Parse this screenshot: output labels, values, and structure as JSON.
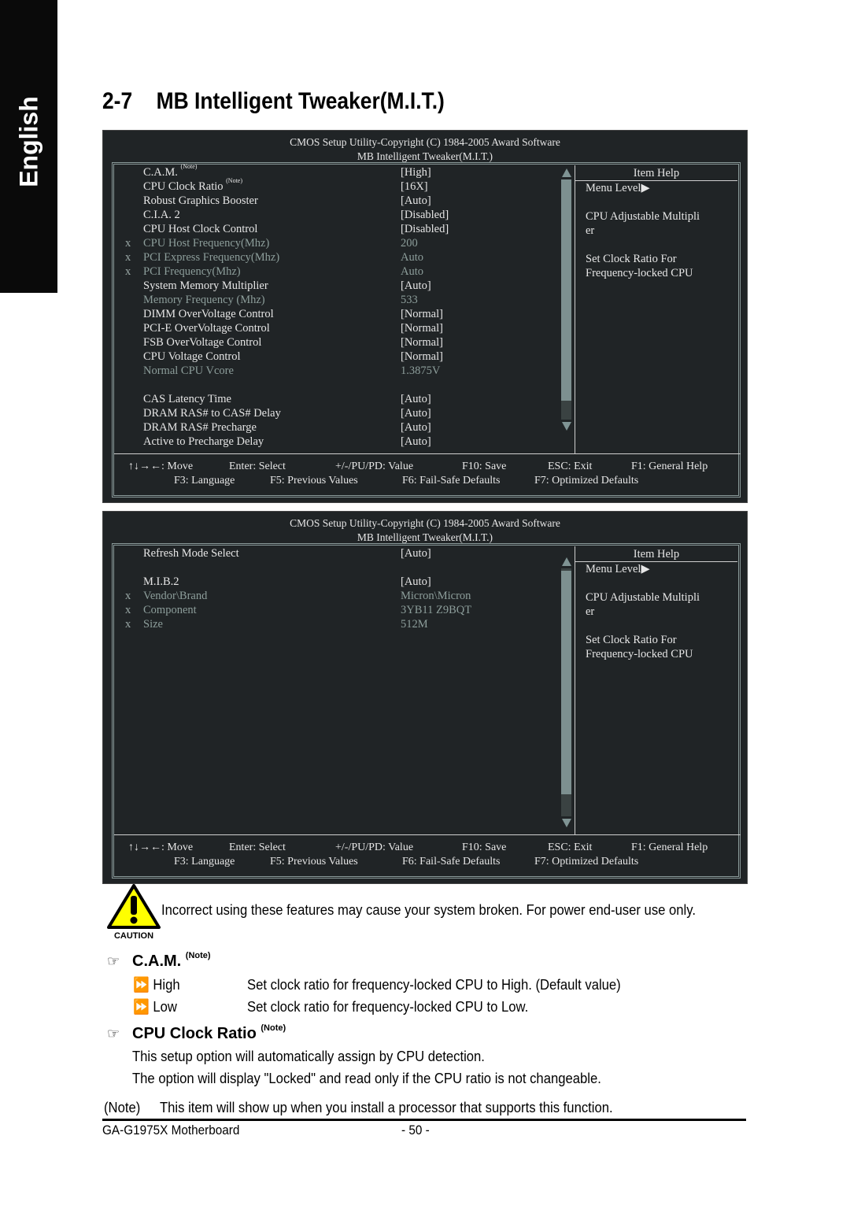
{
  "side_tab": {
    "label": "English"
  },
  "section": {
    "number": "2-7",
    "title": "MB Intelligent Tweaker(M.I.T.)"
  },
  "bios_screen_1": {
    "header_line1": "CMOS Setup Utility-Copyright (C) 1984-2005 Award Software",
    "header_line2": "MB Intelligent Tweaker(M.I.T.)",
    "rows": [
      {
        "mark": "",
        "label": "C.A.M.",
        "note": "(Note)",
        "value": "[High]",
        "dim": false
      },
      {
        "mark": "",
        "label": "CPU Clock Ratio",
        "note": "(Note)",
        "value": "[16X]",
        "dim": false
      },
      {
        "mark": "",
        "label": "Robust Graphics Booster",
        "note": "",
        "value": "[Auto]",
        "dim": false
      },
      {
        "mark": "",
        "label": "C.I.A. 2",
        "note": "",
        "value": "[Disabled]",
        "dim": false
      },
      {
        "mark": "",
        "label": "CPU Host Clock Control",
        "note": "",
        "value": "[Disabled]",
        "dim": false
      },
      {
        "mark": "x",
        "label": "CPU Host Frequency(Mhz)",
        "note": "",
        "value": "200",
        "dim": true
      },
      {
        "mark": "x",
        "label": "PCI Express Frequency(Mhz)",
        "note": "",
        "value": "Auto",
        "dim": true
      },
      {
        "mark": "x",
        "label": "PCI Frequency(Mhz)",
        "note": "",
        "value": "Auto",
        "dim": true
      },
      {
        "mark": "",
        "label": "System Memory Multiplier",
        "note": "",
        "value": "[Auto]",
        "dim": false
      },
      {
        "mark": "",
        "label": "Memory Frequency (Mhz)",
        "note": "",
        "value": "533",
        "dim": true
      },
      {
        "mark": "",
        "label": "DIMM OverVoltage Control",
        "note": "",
        "value": "[Normal]",
        "dim": false
      },
      {
        "mark": "",
        "label": "PCI-E OverVoltage Control",
        "note": "",
        "value": "[Normal]",
        "dim": false
      },
      {
        "mark": "",
        "label": "FSB OverVoltage Control",
        "note": "",
        "value": "[Normal]",
        "dim": false
      },
      {
        "mark": "",
        "label": "CPU Voltage Control",
        "note": "",
        "value": "[Normal]",
        "dim": false
      },
      {
        "mark": "",
        "label": "Normal CPU Vcore",
        "note": "",
        "value": "1.3875V",
        "dim": true
      },
      {
        "mark": "",
        "label": "",
        "note": "",
        "value": "",
        "dim": false
      },
      {
        "mark": "",
        "label": "CAS Latency Time",
        "note": "",
        "value": "[Auto]",
        "dim": false
      },
      {
        "mark": "",
        "label": "DRAM RAS# to CAS# Delay",
        "note": "",
        "value": "[Auto]",
        "dim": false
      },
      {
        "mark": "",
        "label": "DRAM RAS# Precharge",
        "note": "",
        "value": "[Auto]",
        "dim": false
      },
      {
        "mark": "",
        "label": "Active to Precharge Delay",
        "note": "",
        "value": "[Auto]",
        "dim": false
      }
    ],
    "scroll_position": 0.0,
    "scroll_visible_fraction": 0.92,
    "help": {
      "title": "Item Help",
      "lines": [
        "Menu Level▶",
        "",
        "CPU Adjustable Multipli",
        "er",
        "",
        "Set Clock Ratio For",
        "Frequency-locked CPU"
      ]
    }
  },
  "bios_screen_2": {
    "header_line1": "CMOS Setup Utility-Copyright (C) 1984-2005 Award Software",
    "header_line2": "MB Intelligent Tweaker(M.I.T.)",
    "rows": [
      {
        "mark": "",
        "label": "Refresh Mode Select",
        "note": "",
        "value": "[Auto]",
        "dim": false
      },
      {
        "mark": "",
        "label": "",
        "note": "",
        "value": "",
        "dim": false
      },
      {
        "mark": "",
        "label": "M.I.B.2",
        "note": "",
        "value": "[Auto]",
        "dim": false
      },
      {
        "mark": "x",
        "label": "Vendor\\Brand",
        "note": "",
        "value": "Micron\\Micron",
        "dim": true
      },
      {
        "mark": "x",
        "label": "Component",
        "note": "",
        "value": "3YB11 Z9BQT",
        "dim": true
      },
      {
        "mark": "x",
        "label": "Size",
        "note": "",
        "value": "512M",
        "dim": true
      }
    ],
    "scroll_position": 0.1,
    "scroll_visible_fraction": 0.9,
    "help": {
      "title": "Item Help",
      "lines": [
        "Menu Level▶",
        "",
        "CPU Adjustable Multipli",
        "er",
        "",
        "Set Clock Ratio For",
        "Frequency-locked CPU"
      ]
    }
  },
  "footer_keys": {
    "line1": [
      "↑↓→←: Move",
      "Enter: Select",
      "+/-/PU/PD: Value",
      "F10: Save",
      "ESC: Exit",
      "F1: General Help"
    ],
    "line2": [
      "F3: Language",
      "F5: Previous Values",
      "F6: Fail-Safe Defaults",
      "F7: Optimized Defaults"
    ]
  },
  "caution": {
    "icon_label": "CAUTION",
    "text": "Incorrect using these features may cause your system broken. For power end-user use only."
  },
  "cam_section": {
    "title": "C.A.M.",
    "note": "(Note)",
    "options": [
      {
        "name": "High",
        "desc": "Set clock ratio for frequency-locked CPU to High. (Default value)"
      },
      {
        "name": "Low",
        "desc": "Set clock ratio for frequency-locked CPU to Low."
      }
    ]
  },
  "ratio_section": {
    "title": "CPU Clock Ratio",
    "note": "(Note)",
    "lines": [
      "This setup option will automatically assign by CPU detection.",
      "The option will display \"Locked\" and read only if the CPU ratio is not changeable."
    ]
  },
  "note_line": {
    "label": "(Note)",
    "text": "This item will show up when you install a processor that supports this function."
  },
  "page_footer": {
    "product": "GA-G1975X Motherboard",
    "page": "- 50 -"
  }
}
